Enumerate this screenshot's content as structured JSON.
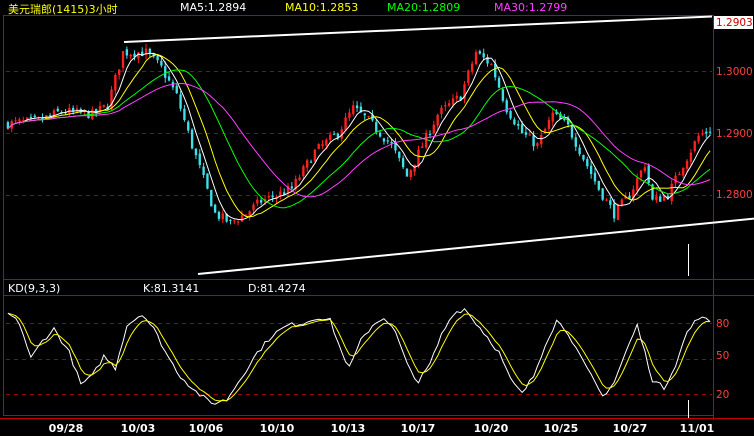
{
  "header": {
    "title": "美元瑞郎(1415)3小时",
    "ma5": "MA5:1.2894",
    "ma10": "MA10:1.2853",
    "ma20": "MA20:1.2809",
    "ma30": "MA30:1.2799"
  },
  "kd_header": {
    "name": "KD(9,3,3)",
    "k": "K:81.3141",
    "d": "D:81.4274"
  },
  "price_labels": {
    "current": "1.2903",
    "t1": "1.3000",
    "t2": "1.2900",
    "t3": "1.2800"
  },
  "kd_labels": {
    "t80": "80",
    "t50": "50",
    "t20": "20"
  },
  "x_labels": [
    "09/28",
    "10/03",
    "10/06",
    "10/10",
    "10/13",
    "10/17",
    "10/20",
    "10/25",
    "10/27",
    "11/01"
  ],
  "colors": {
    "up": "#ff2020",
    "down": "#40e0e8",
    "ma5": "#ffffff",
    "ma10": "#ffff00",
    "ma20": "#00ff00",
    "ma30": "#ff40ff",
    "grid": "#a00000",
    "border": "#c00000",
    "title": "#ffff00"
  },
  "chart_data": [
    {
      "type": "candlestick",
      "series": [
        {
          "name": "MA5",
          "last": 1.2894
        },
        {
          "name": "MA10",
          "last": 1.2853
        },
        {
          "name": "MA20",
          "last": 1.2809
        },
        {
          "name": "MA30",
          "last": 1.2799
        }
      ],
      "x_ticks": [
        "09/28",
        "10/03",
        "10/06",
        "10/10",
        "10/13",
        "10/17",
        "10/20",
        "10/25",
        "10/27",
        "11/01"
      ],
      "y_ticks": [
        1.28,
        1.29,
        1.3
      ],
      "last_price": 1.2903,
      "ylim": [
        1.2733,
        1.3098
      ],
      "path": [
        [
          0,
          1.2915
        ],
        [
          8,
          1.292
        ],
        [
          14,
          1.2935
        ],
        [
          22,
          1.293
        ],
        [
          26,
          1.2945
        ],
        [
          30,
          1.303
        ],
        [
          36,
          1.303
        ],
        [
          40,
          1.3005
        ],
        [
          44,
          1.296
        ],
        [
          48,
          1.288
        ],
        [
          54,
          1.277
        ],
        [
          58,
          1.2755
        ],
        [
          62,
          1.277
        ],
        [
          66,
          1.279
        ],
        [
          70,
          1.28
        ],
        [
          74,
          1.281
        ],
        [
          80,
          1.287
        ],
        [
          86,
          1.29
        ],
        [
          90,
          1.294
        ],
        [
          94,
          1.292
        ],
        [
          100,
          1.288
        ],
        [
          104,
          1.283
        ],
        [
          108,
          1.288
        ],
        [
          112,
          1.293
        ],
        [
          118,
          1.296
        ],
        [
          122,
          1.303
        ],
        [
          126,
          1.301
        ],
        [
          130,
          1.294
        ],
        [
          134,
          1.29
        ],
        [
          138,
          1.288
        ],
        [
          142,
          1.293
        ],
        [
          146,
          1.291
        ],
        [
          150,
          1.286
        ],
        [
          154,
          1.281
        ],
        [
          158,
          1.277
        ],
        [
          162,
          1.28
        ],
        [
          166,
          1.285
        ],
        [
          168,
          1.279
        ],
        [
          172,
          1.28
        ],
        [
          176,
          1.285
        ],
        [
          180,
          1.2895
        ],
        [
          183,
          1.2905
        ]
      ],
      "channel": {
        "upper": [
          [
            22,
            1.305
          ],
          [
            183,
            1.3088
          ]
        ],
        "lower": [
          [
            48,
            1.2747
          ],
          [
            183,
            1.2762
          ]
        ]
      }
    },
    {
      "type": "line",
      "title": "KD(9,3,3)",
      "series": [
        {
          "name": "K",
          "last": 81.3141
        },
        {
          "name": "D",
          "last": 81.4274
        }
      ],
      "y_ticks": [
        20,
        50,
        80
      ],
      "ylim": [
        0,
        100
      ],
      "k_points": [
        [
          0,
          88
        ],
        [
          3,
          80
        ],
        [
          6,
          50
        ],
        [
          9,
          65
        ],
        [
          12,
          75
        ],
        [
          16,
          55
        ],
        [
          19,
          28
        ],
        [
          22,
          35
        ],
        [
          25,
          52
        ],
        [
          28,
          42
        ],
        [
          31,
          78
        ],
        [
          35,
          88
        ],
        [
          38,
          75
        ],
        [
          42,
          50
        ],
        [
          45,
          35
        ],
        [
          49,
          22
        ],
        [
          53,
          12
        ],
        [
          57,
          15
        ],
        [
          61,
          35
        ],
        [
          65,
          55
        ],
        [
          69,
          70
        ],
        [
          73,
          78
        ],
        [
          77,
          80
        ],
        [
          81,
          85
        ],
        [
          84,
          82
        ],
        [
          87,
          55
        ],
        [
          89,
          42
        ],
        [
          92,
          65
        ],
        [
          95,
          78
        ],
        [
          98,
          85
        ],
        [
          101,
          72
        ],
        [
          104,
          45
        ],
        [
          107,
          30
        ],
        [
          110,
          45
        ],
        [
          113,
          70
        ],
        [
          116,
          88
        ],
        [
          119,
          92
        ],
        [
          122,
          80
        ],
        [
          125,
          68
        ],
        [
          128,
          55
        ],
        [
          131,
          32
        ],
        [
          134,
          20
        ],
        [
          137,
          35
        ],
        [
          140,
          62
        ],
        [
          143,
          82
        ],
        [
          146,
          72
        ],
        [
          149,
          52
        ],
        [
          152,
          35
        ],
        [
          155,
          18
        ],
        [
          158,
          30
        ],
        [
          161,
          55
        ],
        [
          164,
          78
        ],
        [
          166,
          55
        ],
        [
          168,
          32
        ],
        [
          171,
          25
        ],
        [
          174,
          45
        ],
        [
          177,
          72
        ],
        [
          180,
          85
        ],
        [
          183,
          81.3
        ]
      ]
    }
  ]
}
